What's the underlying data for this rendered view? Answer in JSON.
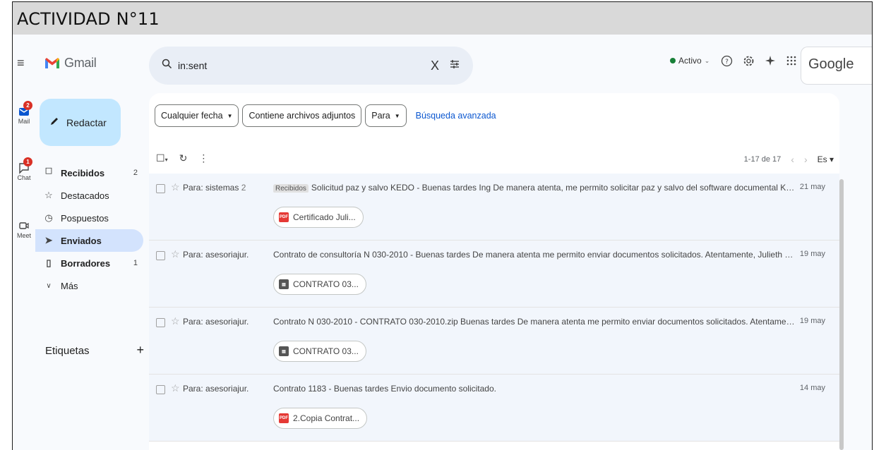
{
  "document": {
    "title": "ACTIVIDAD N°11"
  },
  "rail": {
    "mail_label": "Mail",
    "mail_badge": "2",
    "chat_label": "Chat",
    "chat_badge": "1",
    "meet_label": "Meet"
  },
  "app": {
    "name": "Gmail"
  },
  "search": {
    "query": "in:sent",
    "clear": "X"
  },
  "topbar": {
    "status": "Activo",
    "brand": "Google"
  },
  "compose": {
    "label": "Redactar"
  },
  "nav": [
    {
      "label": "Recibidos",
      "count": "2",
      "icon": "inbox-icon"
    },
    {
      "label": "Destacados",
      "count": "",
      "icon": "star-icon"
    },
    {
      "label": "Pospuestos",
      "count": "",
      "icon": "clock-icon"
    },
    {
      "label": "Enviados",
      "count": "",
      "icon": "send-icon"
    },
    {
      "label": "Borradores",
      "count": "1",
      "icon": "draft-icon"
    },
    {
      "label": "Más",
      "count": "",
      "icon": "chevron-down-icon"
    }
  ],
  "labels": {
    "title": "Etiquetas",
    "add": "+"
  },
  "filters": {
    "date": "Cualquier fecha",
    "attachments": "Contiene archivos adjuntos",
    "to": "Para",
    "advanced": "Búsqueda avanzada"
  },
  "pagination": {
    "range": "1-17 de 17",
    "lang": "Es"
  },
  "emails": [
    {
      "to": "Para: sistemas",
      "to_count": "2",
      "tag": "Recibidos",
      "subject": "Solicitud paz y salvo KEDO",
      "snippet": " - Buenas tardes Ing De manera atenta, me permito solicitar paz y salvo del software documental KEDO a nombre de la contratista Julieth Ni...",
      "date": "21 may",
      "attachment": "Certificado Juli...",
      "attachment_type": "pdf"
    },
    {
      "to": "Para: asesoriajur.",
      "to_count": "",
      "tag": "",
      "subject": "Contrato de consultoría N 030-2010",
      "snippet": " - Buenas tardes De manera atenta me permito enviar documentos solicitados. Atentamente, Julieth Niño Castillo Contratista de Archivo CON...",
      "date": "19 may",
      "attachment": "CONTRATO 03...",
      "attachment_type": "zip"
    },
    {
      "to": "Para: asesoriajur.",
      "to_count": "",
      "tag": "",
      "subject": "Contrato N 030-2010",
      "snippet": " - CONTRATO 030-2010.zip Buenas tardes De manera atenta me permito enviar documentos solicitados. Atentamente, Julieth Niño Castillo Contrstista de A...",
      "date": "19 may",
      "attachment": "CONTRATO 03...",
      "attachment_type": "zip"
    },
    {
      "to": "Para: asesoriajur.",
      "to_count": "",
      "tag": "",
      "subject": "Contrato 1183",
      "snippet": " - Buenas tardes Envio documento solicitado.",
      "date": "14 may",
      "attachment": "2.Copia Contrat...",
      "attachment_type": "pdf"
    }
  ],
  "colors": {
    "accent": "#c2e7ff",
    "active_nav": "#d3e3fd",
    "badge": "#d93025",
    "status": "#188038",
    "link": "#0b57d0"
  }
}
